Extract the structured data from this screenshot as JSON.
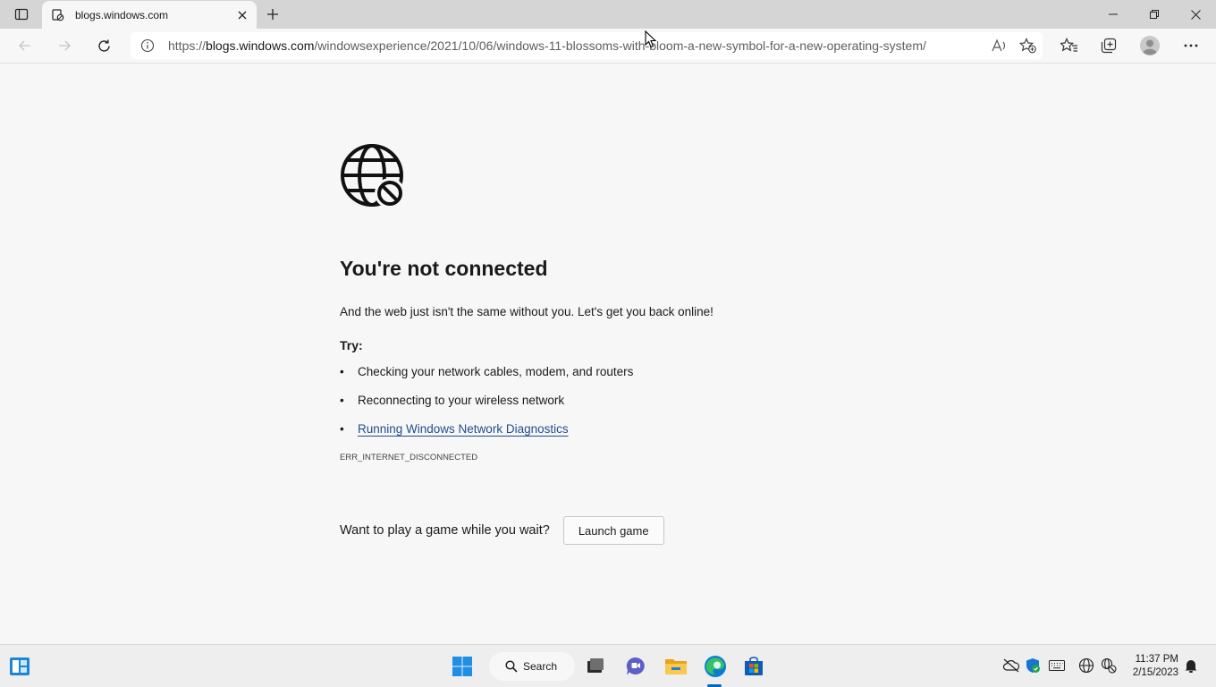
{
  "browser": {
    "tab": {
      "title": "blogs.windows.com"
    },
    "address": {
      "url_prefix": "https://",
      "url_host": "blogs.windows.com",
      "url_path": "/windowsexperience/2021/10/06/windows-11-blossoms-with-bloom-a-new-symbol-for-a-new-operating-system/"
    }
  },
  "error_page": {
    "title": "You're not connected",
    "description": "And the web just isn't the same without you. Let's get you back online!",
    "try_label": "Try:",
    "suggestions": [
      "Checking your network cables, modem, and routers",
      "Reconnecting to your wireless network",
      "Running Windows Network Diagnostics"
    ],
    "error_code": "ERR_INTERNET_DISCONNECTED",
    "game_prompt": "Want to play a game while you wait?",
    "launch_button": "Launch game"
  },
  "taskbar": {
    "search_label": "Search",
    "time": "11:37 PM",
    "date": "2/15/2023"
  },
  "colors": {
    "accent": "#0067c0",
    "link": "#1f4e8c",
    "page_bg": "#f7f7f7",
    "tabbar_bg": "#d5d5d5"
  },
  "icons": [
    "sidebar-toggle-icon",
    "site-favicon-icon",
    "close-icon",
    "plus-icon",
    "minimize-icon",
    "restore-icon",
    "back-arrow-icon",
    "forward-arrow-icon",
    "refresh-icon",
    "info-icon",
    "read-aloud-icon",
    "add-favorite-icon",
    "favorites-icon",
    "collections-icon",
    "profile-icon",
    "more-icon",
    "globe-blocked-icon",
    "widgets-icon",
    "windows-start-icon",
    "search-icon",
    "task-view-icon",
    "chat-icon",
    "file-explorer-icon",
    "edge-icon",
    "store-icon",
    "onedrive-off-icon",
    "defender-icon",
    "keyboard-icon",
    "language-icon",
    "network-off-icon",
    "notifications-icon"
  ]
}
